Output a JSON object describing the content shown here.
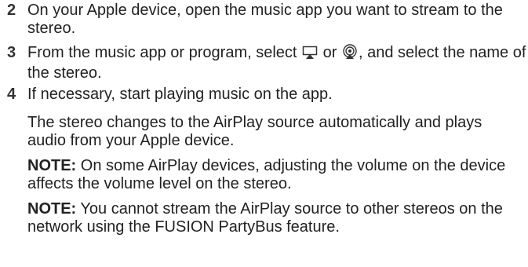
{
  "steps": [
    {
      "number": "2",
      "text": "On your Apple device, open the music app you want to stream to the stereo."
    },
    {
      "number": "3",
      "text_before": "From the music app or program, select",
      "icon1": "airplay-icon",
      "text_or": "or",
      "icon2": "airplay-audio-icon",
      "text_after": ", and select the name of the stereo."
    },
    {
      "number": "4",
      "text": "If necessary, start playing music on the app."
    }
  ],
  "result_text": "The stereo changes to the AirPlay source automatically and plays audio from your Apple device.",
  "notes": [
    {
      "label": "NOTE:",
      "text": "On some AirPlay devices, adjusting the volume on the device affects the volume level on the stereo."
    },
    {
      "label": "NOTE:",
      "text": "You cannot stream the AirPlay source to other stereos on the network using the FUSION PartyBus feature."
    }
  ],
  "colors": {
    "text": "#222222",
    "step_number": "#333333"
  }
}
